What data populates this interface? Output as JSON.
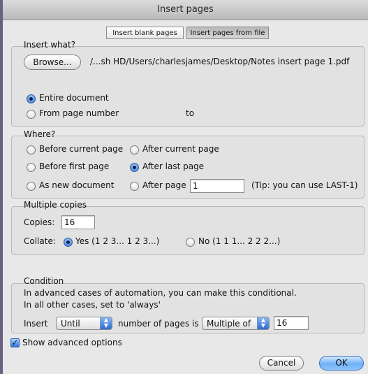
{
  "window": {
    "title": "Insert pages"
  },
  "tabs": [
    {
      "label": "Insert blank pages",
      "selected": false
    },
    {
      "label": "Insert pages from file",
      "selected": true
    }
  ],
  "insert_what": {
    "heading": "Insert what?",
    "browse_label": "Browse...",
    "file_path": "/...sh HD/Users/charlesjames/Desktop/Notes insert page 1.pdf",
    "entire_document_label": "Entire document",
    "from_page_label": "From page number",
    "to_label": "to",
    "selected": "entire_document"
  },
  "where": {
    "heading": "Where?",
    "before_current_label": "Before current page",
    "after_current_label": "After current page",
    "before_first_label": "Before first page",
    "after_last_label": "After last page",
    "as_new_label": "As new document",
    "after_page_label": "After page",
    "after_page_value": "1",
    "tip": "(Tip: you can use LAST-1)",
    "selected": "after_last_page"
  },
  "multiple_copies": {
    "heading": "Multiple copies",
    "copies_label": "Copies:",
    "copies_value": "16",
    "collate_label": "Collate:",
    "yes_label": "Yes (1 2 3... 1 2 3...)",
    "no_label": "No (1 1 1... 2 2 2...)",
    "selected": "yes"
  },
  "condition": {
    "heading": "Condition",
    "line1": "In advanced cases of automation, you can make this conditional.",
    "line2": "In all other cases, set to 'always'",
    "insert_label": "Insert",
    "until_value": "Until",
    "middle_label": "number of pages is",
    "multiple_value": "Multiple of",
    "number_value": "16"
  },
  "advanced": {
    "label": "Show advanced options",
    "checked": true
  },
  "buttons": {
    "cancel": "Cancel",
    "ok": "OK"
  },
  "colors": {
    "accent_blue": "#2f73d8",
    "window_bg": "#e8e8e8",
    "left_border": "#6b5f86"
  },
  "icons": {
    "popup_arrows": "up-down-arrows-icon",
    "checkmark": "checkmark-icon"
  }
}
